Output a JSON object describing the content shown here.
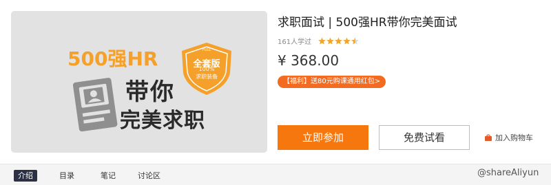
{
  "cover": {
    "line1": "500强HR",
    "line2": "带你",
    "line3": "完美求职",
    "badge_small": "FULL",
    "badge_main": "全套版",
    "badge_percent": "100%",
    "badge_sub": "求职装备",
    "colors": {
      "accent": "#f5a02a",
      "background": "#e2e2e2",
      "text": "#2a2a2a"
    }
  },
  "course": {
    "title": "求职面试 | 500强HR带你完美面试",
    "learners": "161人学过",
    "rating_stars": 4.5,
    "price": "¥ 368.00",
    "promo": "【福利】送80元购课通用红包>"
  },
  "actions": {
    "join_label": "立即参加",
    "preview_label": "免费试看",
    "cart_label": "加入购物车",
    "cart_icon": "shopping-bag-icon"
  },
  "tabs": [
    {
      "label": "介绍",
      "active": true
    },
    {
      "label": "目录",
      "active": false
    },
    {
      "label": "笔记",
      "active": false
    },
    {
      "label": "讨论区",
      "active": false
    }
  ],
  "watermark": "@shareAliyun",
  "colors": {
    "primary": "#f6770e",
    "promo": "#f36b21",
    "star": "#f5a623",
    "tab_active": "#2b3142"
  }
}
